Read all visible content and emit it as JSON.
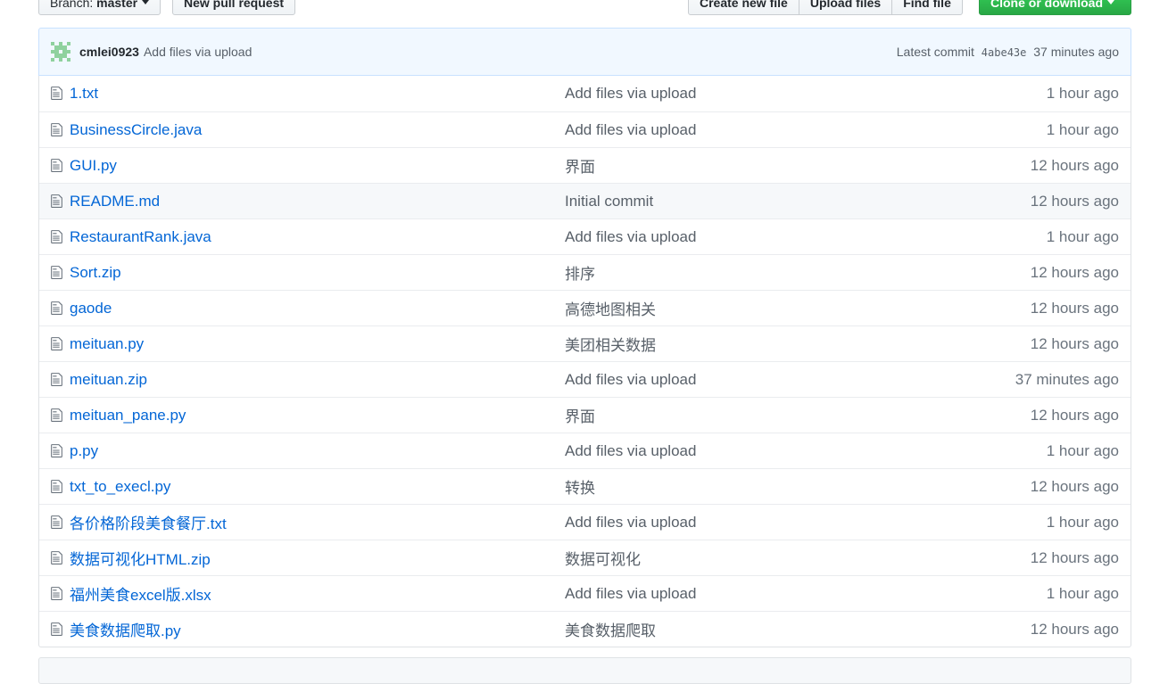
{
  "toolbar": {
    "branch_label": "Branch:",
    "branch_value": "master",
    "new_pull_request": "New pull request",
    "create_new_file": "Create new file",
    "upload_files": "Upload files",
    "find_file": "Find file",
    "clone_or_download": "Clone or download"
  },
  "commit": {
    "author": "cmlei0923",
    "message": "Add files via upload",
    "latest_label": "Latest commit",
    "sha": "4abe43e",
    "age": "37 minutes ago"
  },
  "files": [
    {
      "name": "1.txt",
      "message": "Add files via upload",
      "age": "1 hour ago"
    },
    {
      "name": "BusinessCircle.java",
      "message": "Add files via upload",
      "age": "1 hour ago"
    },
    {
      "name": "GUI.py",
      "message": "界面",
      "age": "12 hours ago"
    },
    {
      "name": "README.md",
      "message": "Initial commit",
      "age": "12 hours ago"
    },
    {
      "name": "RestaurantRank.java",
      "message": "Add files via upload",
      "age": "1 hour ago"
    },
    {
      "name": "Sort.zip",
      "message": "排序",
      "age": "12 hours ago"
    },
    {
      "name": "gaode",
      "message": "高德地图相关",
      "age": "12 hours ago"
    },
    {
      "name": "meituan.py",
      "message": "美团相关数据",
      "age": "12 hours ago"
    },
    {
      "name": "meituan.zip",
      "message": "Add files via upload",
      "age": "37 minutes ago"
    },
    {
      "name": "meituan_pane.py",
      "message": "界面",
      "age": "12 hours ago"
    },
    {
      "name": "p.py",
      "message": "Add files via upload",
      "age": "1 hour ago"
    },
    {
      "name": "txt_to_execl.py",
      "message": "转换",
      "age": "12 hours ago"
    },
    {
      "name": "各价格阶段美食餐厅.txt",
      "message": "Add files via upload",
      "age": "1 hour ago"
    },
    {
      "name": "数据可视化HTML.zip",
      "message": "数据可视化",
      "age": "12 hours ago"
    },
    {
      "name": "福州美食excel版.xlsx",
      "message": "Add files via upload",
      "age": "1 hour ago"
    },
    {
      "name": "美食数据爬取.py",
      "message": "美食数据爬取",
      "age": "12 hours ago"
    }
  ],
  "icons": {
    "file": "file-icon",
    "avatar": "identicon-avatar"
  },
  "colors": {
    "link": "#0366d6",
    "commit_bg": "#f1f8ff",
    "clone_button": "#28a745",
    "avatar": "#8fd19e"
  }
}
